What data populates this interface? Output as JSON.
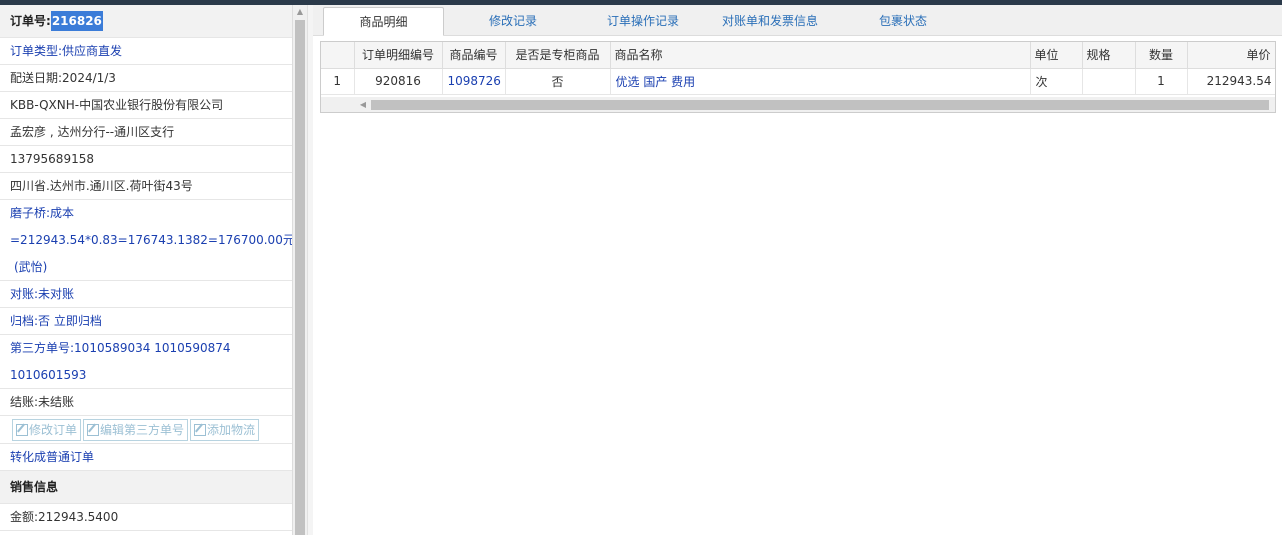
{
  "order": {
    "label": "订单号:",
    "id": "216826"
  },
  "info": {
    "type_label": "订单类型:",
    "type_value": "供应商直发",
    "delivery_date": "配送日期:2024/1/3",
    "company": "KBB-QXNH-中国农业银行股份有限公司",
    "contact": "孟宏彦 , 达州分行--通川区支行",
    "phone": "13795689158",
    "address": "四川省.达州市.通川区.荷叶街43号",
    "cost_label": "磨子桥:",
    "cost_value": "成本",
    "cost_formula": "=212943.54*0.83=176743.1382=176700.00元",
    "cost_person": "(武怡)",
    "reconcile_label": "对账:",
    "reconcile_value": "未对账",
    "archive_label": "归档:",
    "archive_value": "否 立即归档",
    "third_party_label": "第三方单号:",
    "third_party_value_1": "1010589034 1010590874",
    "third_party_value_2": "1010601593",
    "settle_label": "结账:",
    "settle_value": "未结账"
  },
  "buttons": {
    "edit_order": "修改订单",
    "edit_third_party": "编辑第三方单号",
    "add_logistics": "添加物流"
  },
  "convert_link": "转化成普通订单",
  "sales": {
    "header": "销售信息",
    "amount": "金额:212943.5400"
  },
  "tabs": [
    {
      "label": "商品明细",
      "active": true
    },
    {
      "label": "修改记录",
      "active": false
    },
    {
      "label": "订单操作记录",
      "active": false
    },
    {
      "label": "对账单和发票信息",
      "active": false
    },
    {
      "label": "包裹状态",
      "active": false
    }
  ],
  "table": {
    "columns": [
      "",
      "订单明细编号",
      "商品编号",
      "是否是专柜商品",
      "商品名称",
      "单位",
      "规格",
      "数量",
      "单价"
    ],
    "rows": [
      [
        "1",
        "920816",
        "1098726",
        "否",
        "优选 国产 费用",
        "次",
        "",
        "1",
        "212943.54"
      ]
    ]
  },
  "colors": {
    "accent": "#3b7cd8",
    "link": "#1a3fb0",
    "tab_link": "#2a6fb8"
  }
}
